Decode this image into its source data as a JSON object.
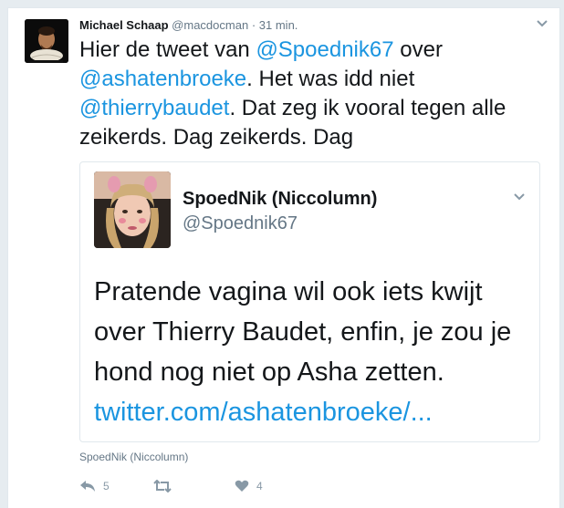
{
  "tweet": {
    "author_name": "Michael Schaap",
    "author_handle": "@macdocman",
    "separator": "·",
    "time": "31 min.",
    "text": {
      "t1": "Hier de tweet van ",
      "mention1": "@Spoednik67",
      "t2": " over ",
      "mention2": "@ashatenbroeke",
      "t3": ". Het was idd niet ",
      "mention3": "@thierrybaudet",
      "t4": ". Dat zeg ik vooral tegen alle zeikerds. Dag zeikerds. Dag"
    },
    "quoted": {
      "name": "SpoedNik (Niccolumn)",
      "handle": "@Spoednik67",
      "text": "Pratende vagina wil ook iets kwijt over Thierry Baudet, enfin, je zou je hond nog niet op Asha zetten.",
      "link": "twitter.com/ashatenbroeke/..."
    },
    "quote_attribution": "SpoedNik (Niccolumn)",
    "actions": {
      "reply_count": "5",
      "retweet_count": "",
      "like_count": "4"
    }
  },
  "colors": {
    "link": "#1b95e0",
    "text": "#14171a",
    "secondary": "#657786",
    "icon": "#8899a6",
    "border": "#e1e8ed",
    "background": "#e6ecf0"
  },
  "icons": {
    "caret": "chevron-down-icon",
    "reply": "reply-icon",
    "retweet": "retweet-icon",
    "like": "heart-icon"
  }
}
